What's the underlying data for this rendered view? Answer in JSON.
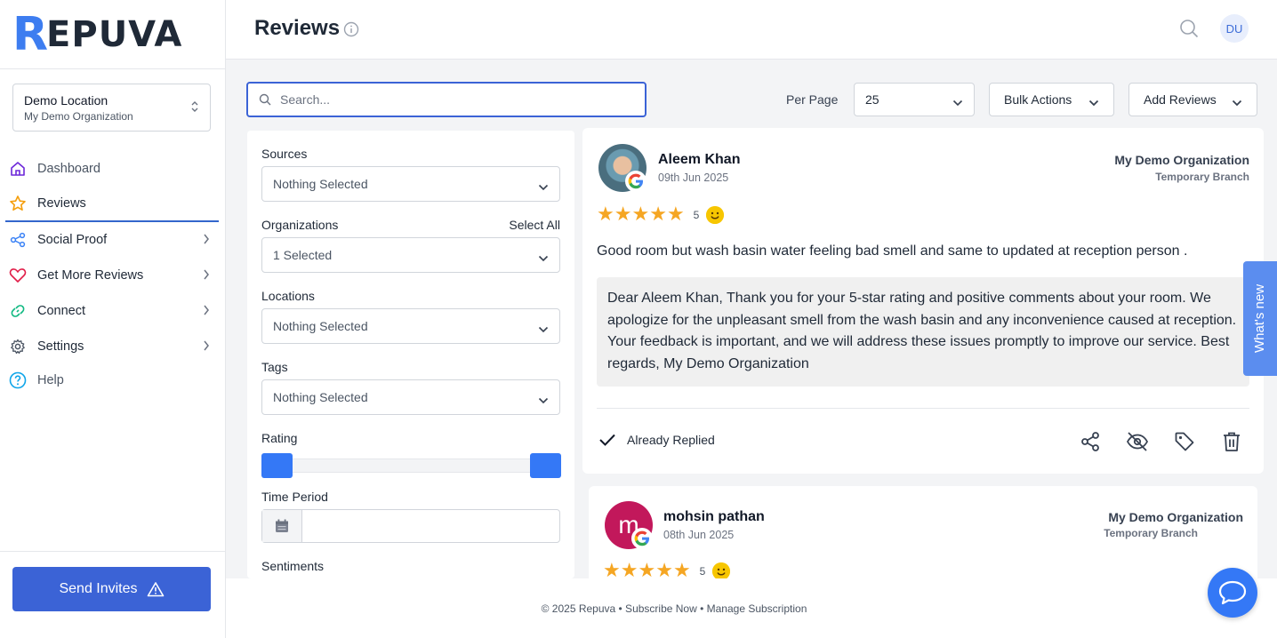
{
  "brand": {
    "logo_letter": "R",
    "logo_text": "EPUVA",
    "accent": "#3b63d6"
  },
  "location_selector": {
    "name": "Demo Location",
    "org": "My Demo Organization"
  },
  "nav": [
    {
      "label": "Dashboard"
    },
    {
      "label": "Reviews"
    },
    {
      "label": "Social Proof"
    },
    {
      "label": "Get More Reviews"
    },
    {
      "label": "Connect"
    },
    {
      "label": "Settings"
    },
    {
      "label": "Help"
    }
  ],
  "send_invites_label": "Send Invites",
  "header": {
    "title": "Reviews",
    "avatar_initials": "DU"
  },
  "toolbar": {
    "search_placeholder": "Search...",
    "per_page_label": "Per Page",
    "per_page_value": "25",
    "bulk_actions": "Bulk Actions",
    "add_reviews": "Add Reviews"
  },
  "filters": {
    "sources_label": "Sources",
    "sources_value": "Nothing Selected",
    "organizations_label": "Organizations",
    "select_all": "Select All",
    "organizations_value": "1 Selected",
    "locations_label": "Locations",
    "locations_value": "Nothing Selected",
    "tags_label": "Tags",
    "tags_value": "Nothing Selected",
    "rating_label": "Rating",
    "time_period_label": "Time Period",
    "time_period_value": "",
    "sentiments_label": "Sentiments"
  },
  "reviews": [
    {
      "name": "Aleem Khan",
      "date": "09th Jun 2025",
      "org": "My Demo Organization",
      "branch": "Temporary Branch",
      "rating": "5",
      "text": "Good room but wash basin water feeling bad smell and same to updated at reception person .",
      "reply": "Dear Aleem Khan, Thank you for your 5-star rating and positive comments about your room. We apologize for the unpleasant smell from the wash basin and any inconvenience caused at reception. Your feedback is important, and we will address these issues promptly to improve our service. Best regards, My Demo Organization",
      "status": "Already Replied"
    },
    {
      "name": "mohsin pathan",
      "initial": "m",
      "date": "08th Jun 2025",
      "org": "My Demo Organization",
      "branch": "Temporary Branch",
      "rating": "5",
      "avatar_color": "#c2185b"
    }
  ],
  "footer": {
    "text": "© 2025 Repuva • Subscribe Now • Manage Subscription"
  },
  "whats_new": "What's new"
}
